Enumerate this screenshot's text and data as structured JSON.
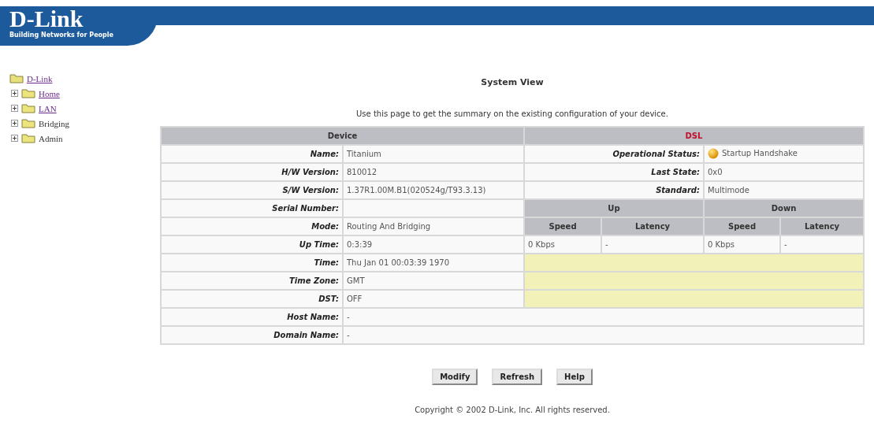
{
  "logo": {
    "name": "D-Link",
    "tagline": "Building Networks for People"
  },
  "tree": {
    "root": {
      "label": "D-Link"
    },
    "items": [
      {
        "label": "Home",
        "link": true,
        "expanded": false
      },
      {
        "label": "LAN",
        "link": true,
        "expanded": false
      },
      {
        "label": "Bridging",
        "link": false,
        "expanded": false
      },
      {
        "label": "Admin",
        "link": false,
        "expanded": false
      }
    ]
  },
  "page": {
    "title": "System View",
    "description": "Use this page to get the summary on the existing configuration of your device."
  },
  "device": {
    "heading": "Device",
    "rows": [
      {
        "label": "Name:",
        "value": "Titanium"
      },
      {
        "label": "H/W Version:",
        "value": "810012"
      },
      {
        "label": "S/W Version:",
        "value": "1.37R1.00M.B1(020524g/T93.3.13)"
      },
      {
        "label": "Serial Number:"
      },
      {
        "label": "Mode:",
        "value": "Routing And Bridging"
      },
      {
        "label": "Up Time:",
        "value": "0:3:39"
      },
      {
        "label": "Time:",
        "value": "Thu Jan 01 00:03:39 1970"
      },
      {
        "label": "Time Zone:",
        "value": "GMT"
      },
      {
        "label": "DST:",
        "value": "OFF"
      },
      {
        "label": "Host Name:",
        "value": "-"
      },
      {
        "label": "Domain Name:",
        "value": "-"
      }
    ]
  },
  "dsl": {
    "heading": "DSL",
    "rows": [
      {
        "label": "Operational Status:",
        "value": "Startup Handshake",
        "kind": "status"
      },
      {
        "label": "Last State:",
        "value": "0x0",
        "kind": "plain"
      },
      {
        "label": "Standard:",
        "value": "Multimode",
        "kind": "plain"
      }
    ],
    "groups": [
      "Up",
      "Down"
    ],
    "columns": [
      "Speed",
      "Latency",
      "Speed",
      "Latency"
    ],
    "values": [
      "0 Kbps",
      "-",
      "0 Kbps",
      "-"
    ]
  },
  "buttons": [
    "Modify",
    "Refresh",
    "Help"
  ],
  "copyright": "Copyright © 2002 D-Link, Inc. All rights reserved."
}
